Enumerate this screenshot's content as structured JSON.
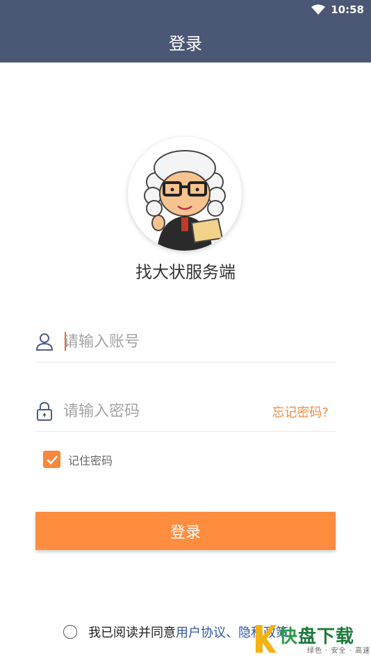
{
  "status_bar": {
    "time": "10:58"
  },
  "header": {
    "title": "登录"
  },
  "app": {
    "name": "找大状服务端"
  },
  "form": {
    "account_placeholder": "请输入账号",
    "password_placeholder": "请输入密码",
    "forgot_password": "忘记密码?",
    "remember_password": "记住密码",
    "remember_checked": true,
    "login_button": "登录"
  },
  "agreement": {
    "prefix": "我已阅读并同意",
    "user_agreement": "用户协议",
    "separator": "、",
    "truncated": "隐私政策"
  },
  "watermark": {
    "first_char": "快",
    "rest": "盘下载",
    "tagline": "绿色 · 安全 · 高速"
  },
  "colors": {
    "header_bg": "#4a5775",
    "accent": "#ff8c3f",
    "link": "#2d55a6"
  }
}
